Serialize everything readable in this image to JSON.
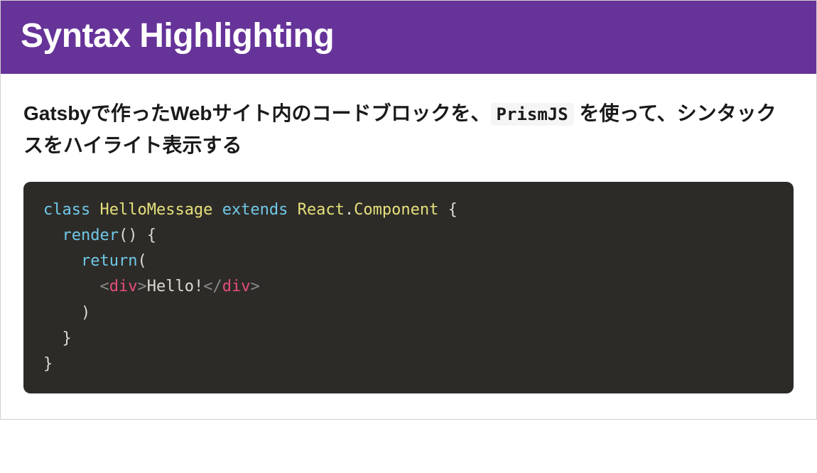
{
  "header": {
    "title": "Syntax Highlighting"
  },
  "description": {
    "part1": "Gatsbyで作ったWebサイト内のコードブロックを、",
    "inline_code": "PrismJS",
    "part2": " を使って、シンタックスをハイライト表示する"
  },
  "code": {
    "tokens": [
      {
        "t": "class",
        "c": "tok-keyword"
      },
      {
        "t": " ",
        "c": "tok-text"
      },
      {
        "t": "HelloMessage",
        "c": "tok-class"
      },
      {
        "t": " ",
        "c": "tok-text"
      },
      {
        "t": "extends",
        "c": "tok-keyword"
      },
      {
        "t": " ",
        "c": "tok-text"
      },
      {
        "t": "React",
        "c": "tok-class"
      },
      {
        "t": ".",
        "c": "tok-punct"
      },
      {
        "t": "Component",
        "c": "tok-class"
      },
      {
        "t": " {",
        "c": "tok-punct"
      },
      {
        "t": "\n  ",
        "c": "tok-text"
      },
      {
        "t": "render",
        "c": "tok-func"
      },
      {
        "t": "() {",
        "c": "tok-punct"
      },
      {
        "t": "\n    ",
        "c": "tok-text"
      },
      {
        "t": "return",
        "c": "tok-keyword"
      },
      {
        "t": "(",
        "c": "tok-punct"
      },
      {
        "t": "\n      ",
        "c": "tok-text"
      },
      {
        "t": "<",
        "c": "tok-angle"
      },
      {
        "t": "div",
        "c": "tok-tag"
      },
      {
        "t": ">",
        "c": "tok-angle"
      },
      {
        "t": "Hello!",
        "c": "tok-text"
      },
      {
        "t": "</",
        "c": "tok-angle"
      },
      {
        "t": "div",
        "c": "tok-tag"
      },
      {
        "t": ">",
        "c": "tok-angle"
      },
      {
        "t": "\n    )",
        "c": "tok-punct"
      },
      {
        "t": "\n  }",
        "c": "tok-punct"
      },
      {
        "t": "\n}",
        "c": "tok-punct"
      }
    ]
  }
}
